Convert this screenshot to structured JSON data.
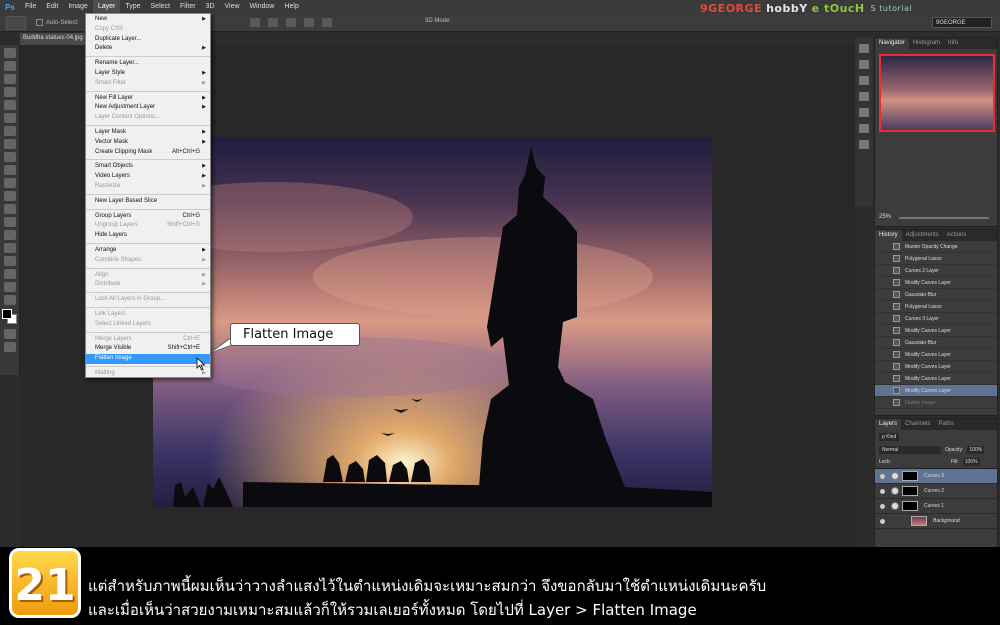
{
  "app": {
    "logo": "Ps"
  },
  "menubar": {
    "items": [
      "File",
      "Edit",
      "Image",
      "Layer",
      "Type",
      "Select",
      "Filter",
      "3D",
      "View",
      "Window",
      "Help"
    ],
    "active": "Layer"
  },
  "brand": {
    "part1": "9GEORGE",
    "part2": "hobbY",
    "part3": "e tOucH",
    "sub": "S tutorial"
  },
  "options_bar": {
    "auto_select": "Auto-Select:",
    "mode_3d": "3D Mode:",
    "workspace": "9GEORGE"
  },
  "document": {
    "tab": "Buddha statues 04.jpg"
  },
  "layer_menu": [
    {
      "label": "New",
      "submenu": true
    },
    {
      "label": "Copy CSS",
      "disabled": true
    },
    {
      "label": "Duplicate Layer..."
    },
    {
      "label": "Delete",
      "submenu": true
    },
    {
      "sep": true
    },
    {
      "label": "Rename Layer..."
    },
    {
      "label": "Layer Style",
      "submenu": true
    },
    {
      "label": "Smart Filter",
      "submenu": true,
      "disabled": true
    },
    {
      "sep": true
    },
    {
      "label": "New Fill Layer",
      "submenu": true
    },
    {
      "label": "New Adjustment Layer",
      "submenu": true
    },
    {
      "label": "Layer Content Options...",
      "disabled": true
    },
    {
      "sep": true
    },
    {
      "label": "Layer Mask",
      "submenu": true
    },
    {
      "label": "Vector Mask",
      "submenu": true
    },
    {
      "label": "Create Clipping Mask",
      "shortcut": "Alt+Ctrl+G"
    },
    {
      "sep": true
    },
    {
      "label": "Smart Objects",
      "submenu": true
    },
    {
      "label": "Video Layers",
      "submenu": true
    },
    {
      "label": "Rasterize",
      "submenu": true,
      "disabled": true
    },
    {
      "sep": true
    },
    {
      "label": "New Layer Based Slice"
    },
    {
      "sep": true
    },
    {
      "label": "Group Layers",
      "shortcut": "Ctrl+G"
    },
    {
      "label": "Ungroup Layers",
      "shortcut": "Shift+Ctrl+G",
      "disabled": true
    },
    {
      "label": "Hide Layers"
    },
    {
      "sep": true
    },
    {
      "label": "Arrange",
      "submenu": true
    },
    {
      "label": "Combine Shapes",
      "submenu": true,
      "disabled": true
    },
    {
      "sep": true
    },
    {
      "label": "Align",
      "submenu": true,
      "disabled": true
    },
    {
      "label": "Distribute",
      "submenu": true,
      "disabled": true
    },
    {
      "sep": true
    },
    {
      "label": "Lock All Layers in Group...",
      "disabled": true
    },
    {
      "sep": true
    },
    {
      "label": "Link Layers",
      "disabled": true
    },
    {
      "label": "Select Linked Layers",
      "disabled": true
    },
    {
      "sep": true
    },
    {
      "label": "Merge Layers",
      "shortcut": "Ctrl+E",
      "disabled": true
    },
    {
      "label": "Merge Visible",
      "shortcut": "Shift+Ctrl+E"
    },
    {
      "label": "Flatten Image",
      "highlight": true
    },
    {
      "sep": true
    },
    {
      "label": "Matting",
      "submenu": true,
      "disabled": true
    }
  ],
  "callout": {
    "text": "Flatten Image"
  },
  "navigator": {
    "tabs": [
      "Navigator",
      "Histogram",
      "Info"
    ],
    "zoom": "25%"
  },
  "history": {
    "tabs": [
      "History",
      "Adjustments",
      "Actions"
    ],
    "items": [
      {
        "label": "Master Opacity Change"
      },
      {
        "label": "Polygonal Lasso"
      },
      {
        "label": "Curves 2 Layer"
      },
      {
        "label": "Modify Curves Layer"
      },
      {
        "label": "Gaussian Blur"
      },
      {
        "label": "Polygonal Lasso"
      },
      {
        "label": "Curves 3 Layer"
      },
      {
        "label": "Modify Curves Layer"
      },
      {
        "label": "Gaussian Blur"
      },
      {
        "label": "Modify Curves Layer"
      },
      {
        "label": "Modify Curves Layer"
      },
      {
        "label": "Modify Curves Layer"
      },
      {
        "label": "Modify Curves Layer",
        "selected": true
      },
      {
        "label": "Flatten Image",
        "dim": true
      }
    ]
  },
  "layers": {
    "tabs": [
      "Layers",
      "Channels",
      "Paths"
    ],
    "kind": "ρ Kind",
    "blend": "Normal",
    "opacity_label": "Opacity:",
    "opacity": "100%",
    "lock_label": "Lock:",
    "fill_label": "Fill:",
    "fill": "100%",
    "items": [
      {
        "name": "Curves 3",
        "selected": true
      },
      {
        "name": "Curves 2"
      },
      {
        "name": "Curves 1"
      },
      {
        "name": "Background",
        "background": true
      }
    ]
  },
  "caption": {
    "step": "21",
    "line1": "แต่สำหรับภาพนี้ผมเห็นว่าวางลำแสงไว้ในตำแหน่งเดิมจะเหมาะสมกว่า จึงขอกลับมาใช้ตำแหน่งเดิมนะครับ",
    "line2": "และเมื่อเห็นว่าสวยงามเหมาะสมแล้วก็ให้รวมเลเยอร์ทั้งหมด โดยไปที่ Layer > Flatten Image"
  }
}
